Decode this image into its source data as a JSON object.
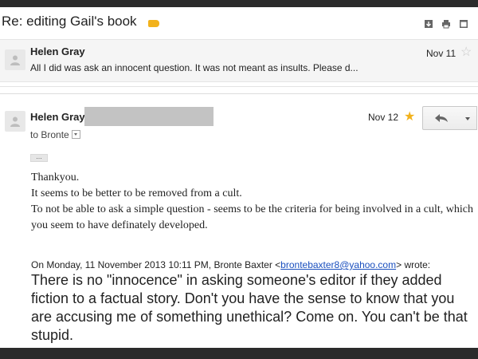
{
  "subject": "Re: editing Gail's book",
  "icons": [
    "download-icon",
    "print-icon",
    "new-window-icon"
  ],
  "messages": [
    {
      "sender": "Helen Gray",
      "snippet": "All I did was ask an innocent question. It was not meant as insults. Please d...",
      "date": "Nov 11",
      "starred": false
    },
    {
      "sender": "Helen Gray",
      "to_label": "to Bronte",
      "date": "Nov 12",
      "starred": true,
      "body": [
        "Thankyou.",
        "It seems to be better to be removed from a cult.",
        "To not be able to ask a simple question - seems to be the criteria for being involved in a cult, which you seem to have definately developed."
      ],
      "quote_header_prefix": "On Monday, 11 November 2013 10:11 PM, Bronte Baxter <",
      "quote_email": "brontebaxter8@yahoo.com",
      "quote_header_suffix": "> wrote:",
      "quote_text": "There is no \"innocence\" in asking someone's editor if they added fiction to a factual story. Don't you have the sense to know that you are accusing me of something unethical? Come on. You can't be that stupid."
    }
  ],
  "colors": {
    "label": "#f2b21c",
    "star_on": "#f2b21c",
    "link": "#1a4fbe"
  }
}
